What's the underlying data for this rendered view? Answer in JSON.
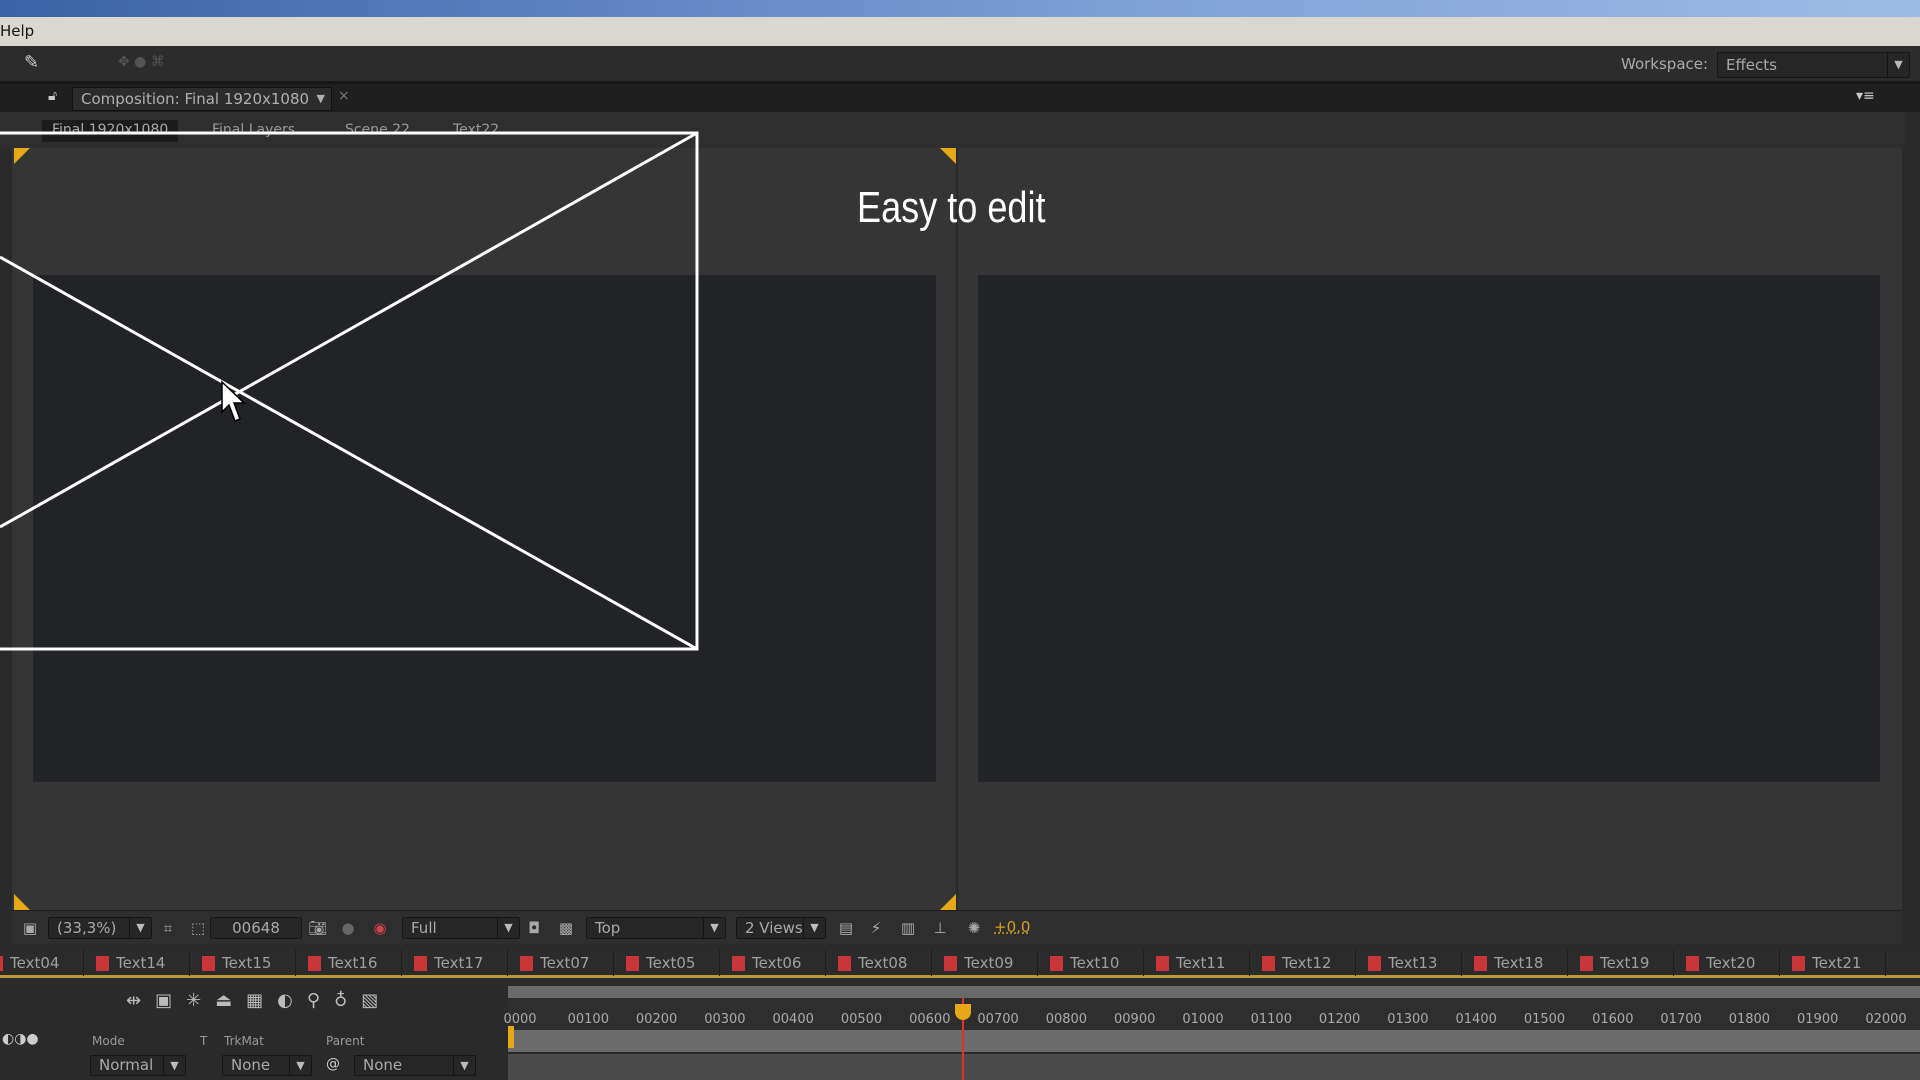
{
  "menu": {
    "help": "Help"
  },
  "toolbar": {
    "workspace_label": "Workspace:",
    "workspace_value": "Effects"
  },
  "panel": {
    "comp_tab": "Composition: Final 1920x1080",
    "breadcrumbs": [
      "Final 1920x1080",
      "Final Layers",
      "Scene 22",
      "Text22"
    ]
  },
  "viewer": {
    "overlay_text": "Easy to edit",
    "accent": "#e6a817"
  },
  "viewer_toolbar": {
    "zoom": "(33,3%)",
    "timecode": "00648",
    "resolution": "Full",
    "view": "Top",
    "views": "2 Views",
    "offset": "+0,0"
  },
  "layer_tabs": [
    "Text04",
    "Text14",
    "Text15",
    "Text16",
    "Text17",
    "Text07",
    "Text05",
    "Text06",
    "Text08",
    "Text09",
    "Text10",
    "Text11",
    "Text12",
    "Text13",
    "Text18",
    "Text19",
    "Text20",
    "Text21"
  ],
  "label_color": "#c8363a",
  "timeline": {
    "ruler": [
      "0000",
      "00100",
      "00200",
      "00300",
      "00400",
      "00500",
      "00600",
      "00700",
      "00800",
      "00900",
      "01000",
      "01100",
      "01200",
      "01300",
      "01400",
      "01500",
      "01600",
      "01700",
      "01800",
      "01900",
      "02000"
    ],
    "current_frame": 648,
    "columns": {
      "mode": "Mode",
      "t": "T",
      "trkmat": "TrkMat",
      "parent": "Parent"
    },
    "layer": {
      "mode": "Normal",
      "trkmat": "None",
      "parent": "None"
    }
  }
}
